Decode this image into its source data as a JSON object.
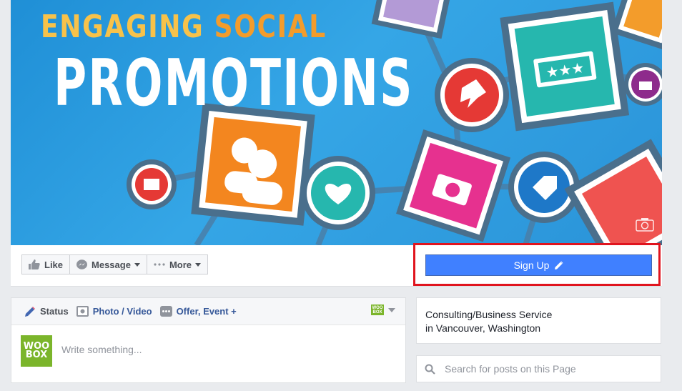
{
  "cover": {
    "title_word_1": "ENGAGING",
    "title_word_2": "SOCIAL",
    "title_line_2": "PROMOTIONS",
    "camera_icon": "camera-icon"
  },
  "actions": {
    "like_label": "Like",
    "message_label": "Message",
    "more_label": "More",
    "signup_label": "Sign Up"
  },
  "composer": {
    "tabs": [
      {
        "label": "Status",
        "icon": "pencil-icon"
      },
      {
        "label": "Photo / Video",
        "icon": "camera-icon"
      },
      {
        "label": "Offer, Event +",
        "icon": "ellipsis-icon"
      }
    ],
    "page_logo_text": "WOO BOX",
    "placeholder": "Write something..."
  },
  "about": {
    "category": "Consulting/Business Service",
    "location": "in Vancouver, Washington"
  },
  "search": {
    "placeholder": "Search for posts on this Page"
  },
  "colors": {
    "primary_blue": "#4080ff",
    "highlight_red": "#e0141e",
    "woobox_green": "#7bb52b",
    "page_bg": "#e9ebee"
  }
}
